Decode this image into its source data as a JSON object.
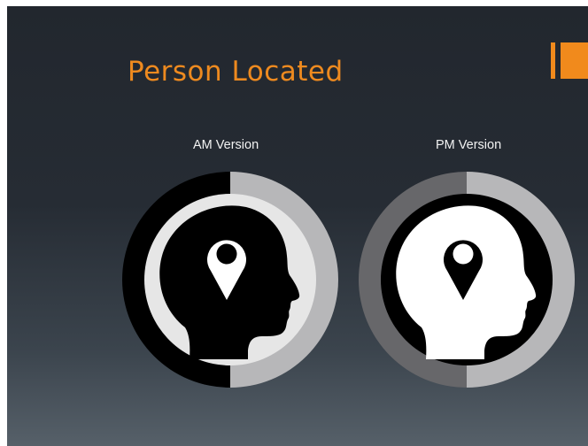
{
  "slide": {
    "title": "Person Located",
    "accent_color": "#f18a1c"
  },
  "versions": [
    {
      "label": "AM Version",
      "icon": "head-location-pin-icon",
      "ring_colors": [
        "#000000",
        "#b7b7b9"
      ],
      "inner_background": "#e6e6e6",
      "head_color": "#000000"
    },
    {
      "label": "PM Version",
      "icon": "head-location-pin-icon",
      "ring_colors": [
        "#67676a",
        "#b7b7b9"
      ],
      "inner_background": "#000000",
      "head_color": "#ffffff"
    }
  ]
}
